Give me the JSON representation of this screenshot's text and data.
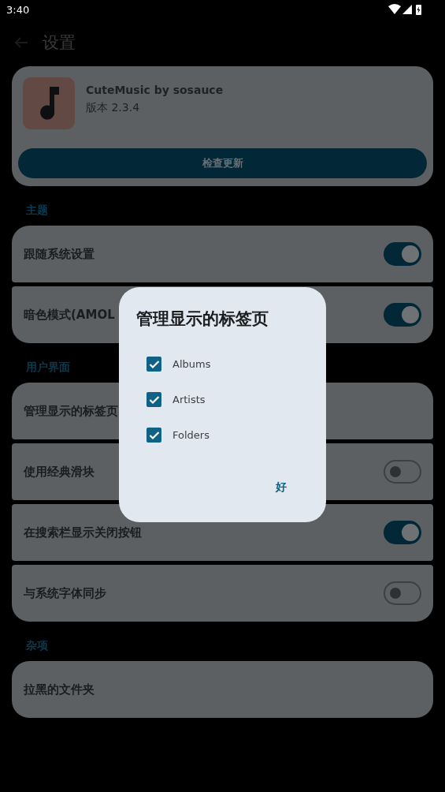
{
  "status_bar": {
    "time": "3:40"
  },
  "app_bar": {
    "title": "设置"
  },
  "about_card": {
    "app_name": "CuteMusic by sosauce",
    "version": "版本 2.3.4",
    "update_button": "检查更新"
  },
  "sections": [
    {
      "title": "主题",
      "rows": [
        {
          "kind": "toggle",
          "label": "跟随系统设置",
          "on": true
        },
        {
          "kind": "toggle",
          "label": "暗色模式(AMOL",
          "on": true
        }
      ]
    },
    {
      "title": "用户界面",
      "rows": [
        {
          "kind": "plain",
          "label": "管理显示的标签页"
        },
        {
          "kind": "toggle",
          "label": "使用经典滑块",
          "on": false
        },
        {
          "kind": "toggle",
          "label": "在搜索栏显示关闭按钮",
          "on": true
        },
        {
          "kind": "toggle",
          "label": "与系统字体同步",
          "on": false
        }
      ]
    },
    {
      "title": "杂项",
      "rows": [
        {
          "kind": "plain",
          "label": "拉黑的文件夹"
        }
      ]
    }
  ],
  "dialog": {
    "title": "管理显示的标签页",
    "options": [
      {
        "label": "Albums",
        "checked": true
      },
      {
        "label": "Artists",
        "checked": true
      },
      {
        "label": "Folders",
        "checked": true
      }
    ],
    "confirm_button": "好"
  }
}
